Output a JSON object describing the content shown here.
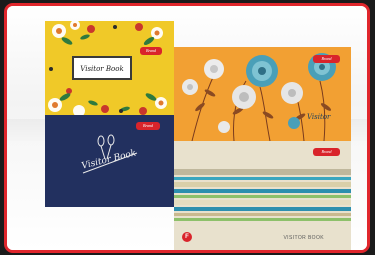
{
  "image": {
    "description_colors": {
      "frame_border": "#e0262c",
      "yellow_cover": "#f0c928",
      "navy_cover": "#22305f",
      "orange_cover": "#f2a033",
      "stripes_base": "#e8e1cd",
      "brand_tag": "#d9242b"
    },
    "covers": {
      "yellow": {
        "title": "Visitor Book",
        "brand": "Brand"
      },
      "navy": {
        "title": "Visitor Book",
        "brand": "Brand"
      },
      "orange": {
        "title": "Visitor",
        "brand": "Brand"
      },
      "stripes": {
        "title": "VISITOR BOOK",
        "brand": "Brand",
        "badge": "F"
      }
    }
  }
}
